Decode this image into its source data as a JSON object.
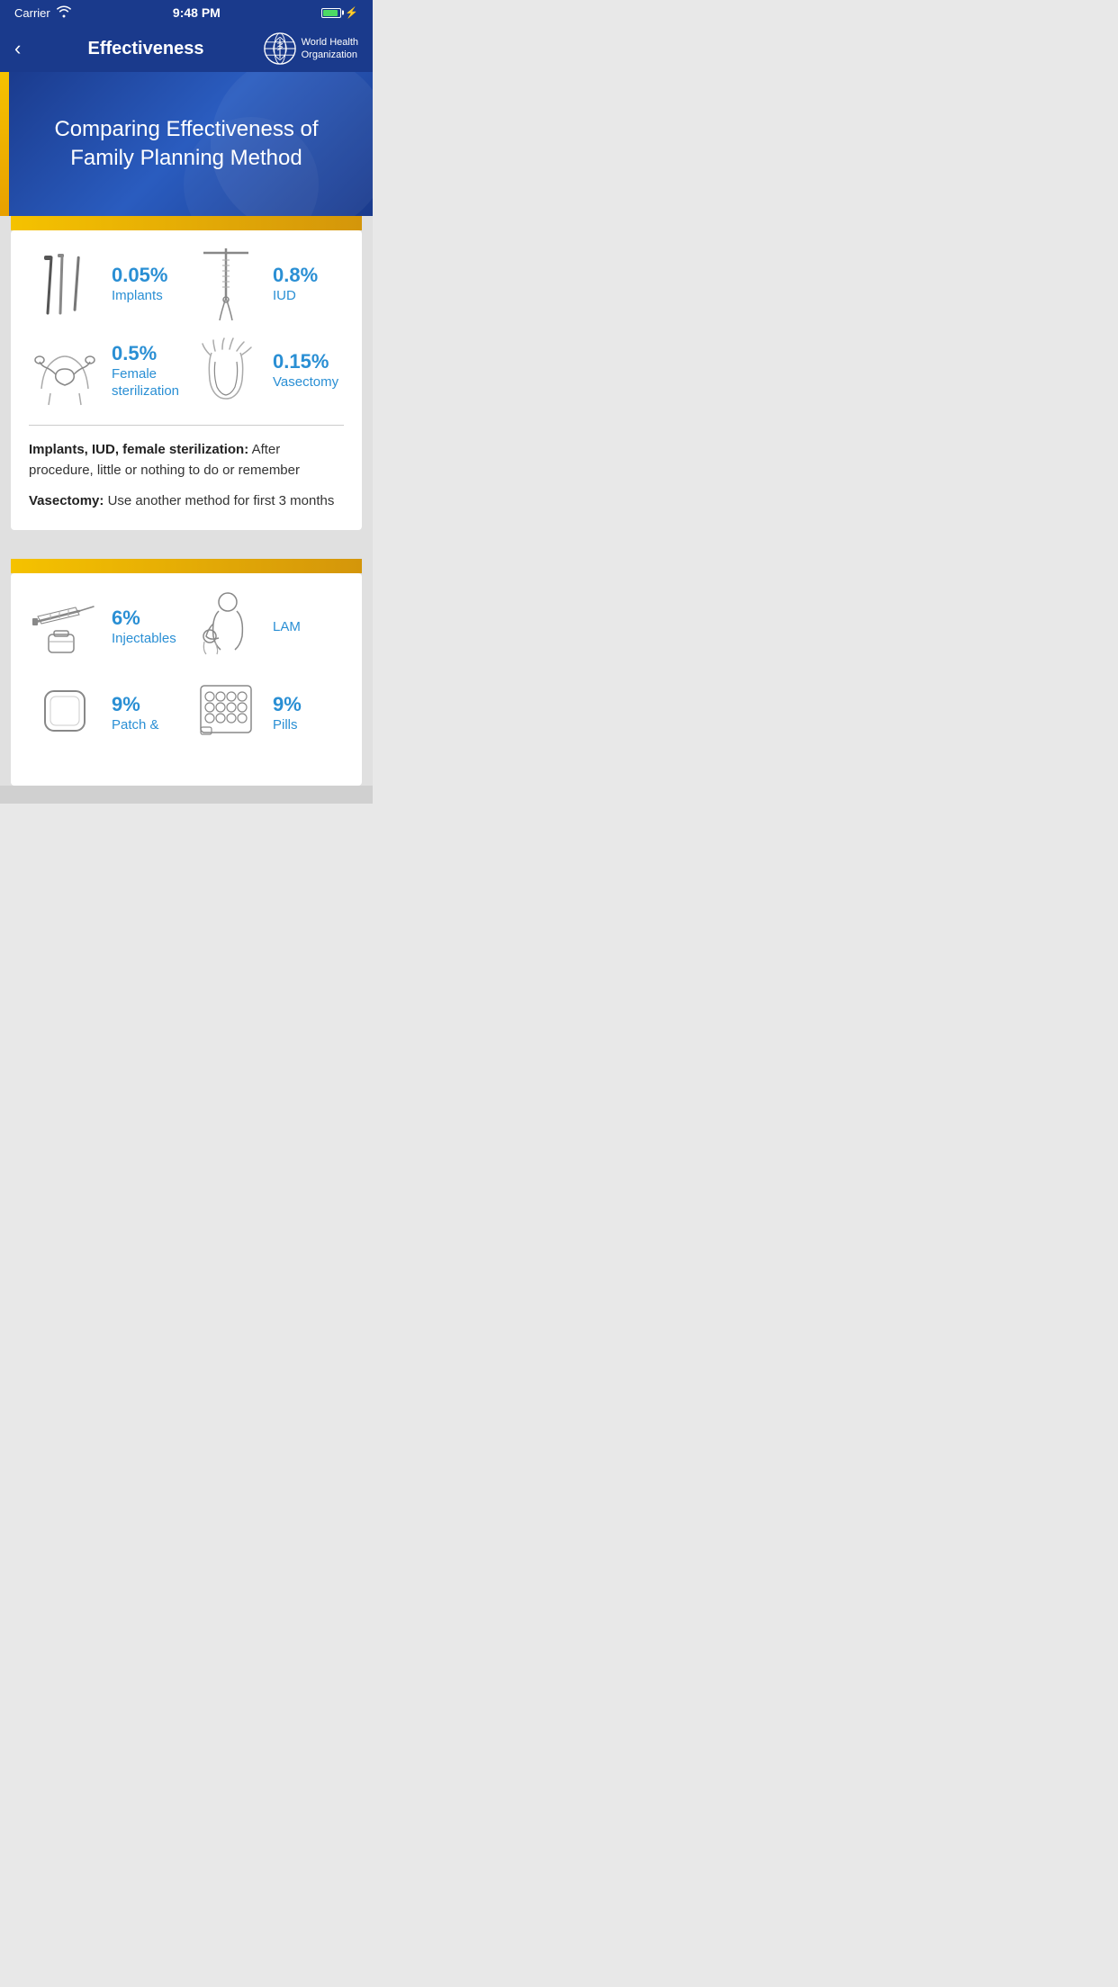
{
  "statusBar": {
    "carrier": "Carrier",
    "time": "9:48 PM",
    "battery": "100"
  },
  "navBar": {
    "backLabel": "‹",
    "title": "Effectiveness",
    "whoLine1": "World Health",
    "whoLine2": "Organization"
  },
  "hero": {
    "title": "Comparing Effectiveness of Family Planning Method"
  },
  "card1": {
    "goldBar": true,
    "methods": [
      {
        "id": "implants",
        "percent": "0.05%",
        "name": "Implants",
        "iconType": "implants"
      },
      {
        "id": "iud",
        "percent": "0.8%",
        "name": "IUD",
        "iconType": "iud"
      },
      {
        "id": "female-sterilization",
        "percent": "0.5%",
        "name": "Female sterilization",
        "iconType": "female-sterilization"
      },
      {
        "id": "vasectomy",
        "percent": "0.15%",
        "name": "Vasectomy",
        "iconType": "vasectomy"
      }
    ],
    "notes": [
      {
        "bold": "Implants, IUD, female sterilization:",
        "text": " After procedure, little or nothing to do or remember"
      },
      {
        "bold": "Vasectomy:",
        "text": " Use another method for first 3 months"
      }
    ]
  },
  "card2": {
    "goldBar": true,
    "methods": [
      {
        "id": "injectables",
        "percent": "6%",
        "name": "Injectables",
        "iconType": "injectables"
      },
      {
        "id": "lam",
        "percent": "",
        "name": "LAM",
        "iconType": "lam"
      },
      {
        "id": "patch",
        "percent": "9%",
        "name": "Patch &",
        "iconType": "patch"
      },
      {
        "id": "pills",
        "percent": "9%",
        "name": "Pills",
        "iconType": "pills"
      }
    ]
  }
}
